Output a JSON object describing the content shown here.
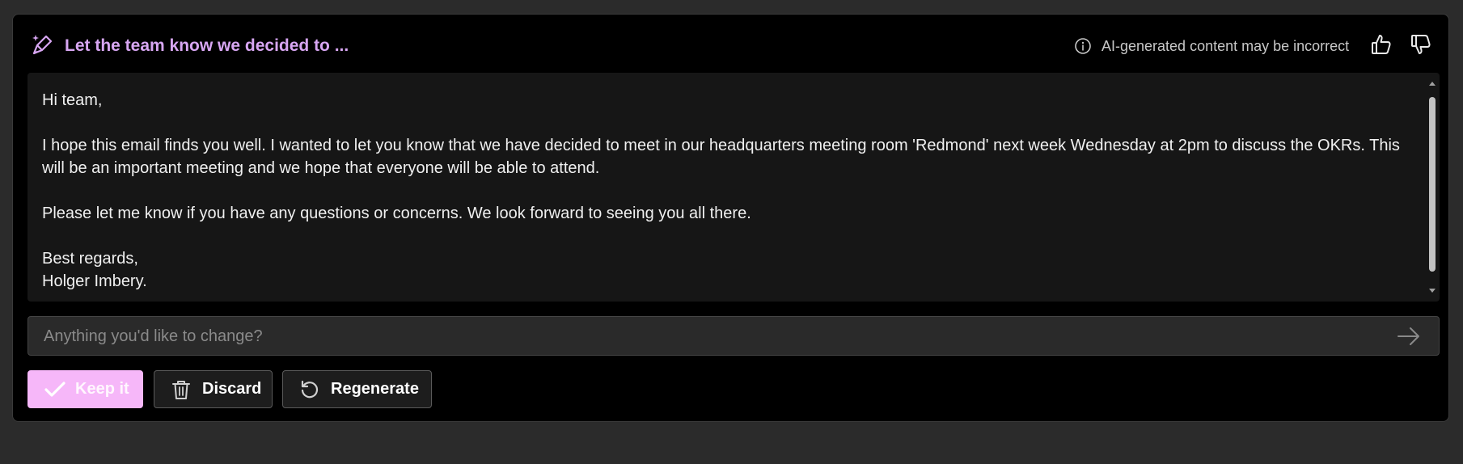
{
  "header": {
    "title": "Let the team know we decided to ...",
    "title_icon": "pen-sparkle-icon",
    "disclaimer": "AI-generated content may be incorrect",
    "info_icon": "info-icon",
    "like_icon": "thumbs-up-icon",
    "dislike_icon": "thumbs-down-icon"
  },
  "draft": {
    "greeting": "Hi team,",
    "paragraph1": "I hope this email finds you well. I wanted to let you know that we have decided to meet in our headquarters meeting room 'Redmond' next week Wednesday at 2pm to discuss the OKRs. This will be an important meeting and we hope that everyone will be able to attend.",
    "paragraph2": "Please let me know if you have any questions or concerns. We look forward to seeing you all there.",
    "closing": "Best regards,",
    "signature": "Holger Imbery."
  },
  "prompt": {
    "placeholder": "Anything you'd like to change?",
    "value": "",
    "send_icon": "arrow-right-icon"
  },
  "actions": {
    "keep_label": "Keep it",
    "discard_label": "Discard",
    "regenerate_label": "Regenerate"
  },
  "colors": {
    "accent": "#d7a6f2",
    "keep_button_bg": "#f6b7f9",
    "card_bg": "#000000",
    "draft_bg": "#161616",
    "page_bg": "#2b2b2b"
  }
}
